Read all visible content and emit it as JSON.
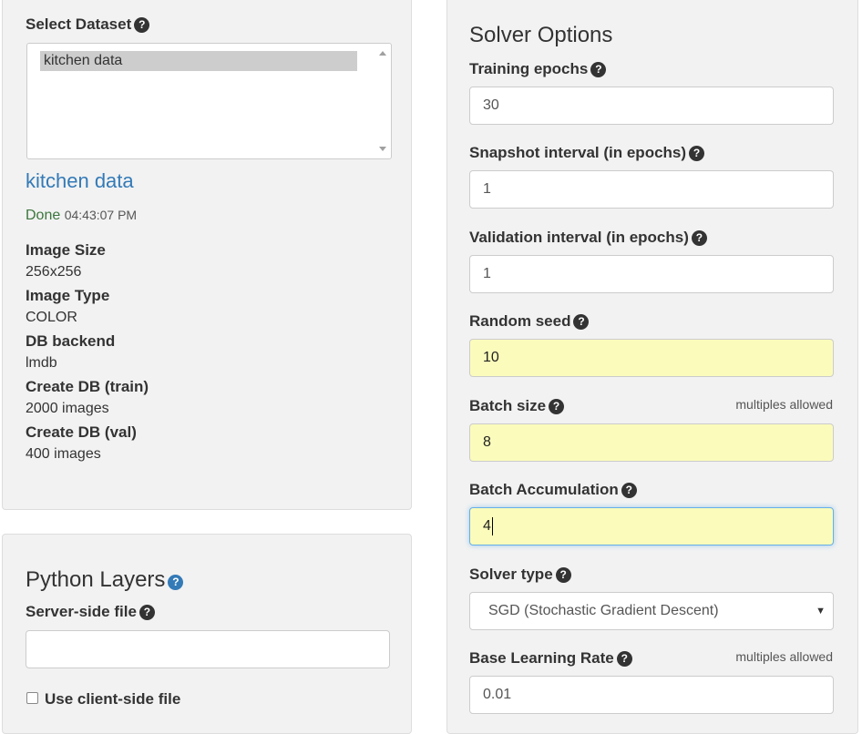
{
  "dataset": {
    "title": "Select Dataset",
    "options": [
      "kitchen data"
    ],
    "selected_name": "kitchen data",
    "status": "Done",
    "time": "04:43:07 PM",
    "info": [
      {
        "key": "Image Size",
        "value": "256x256"
      },
      {
        "key": "Image Type",
        "value": "COLOR"
      },
      {
        "key": "DB backend",
        "value": "lmdb"
      },
      {
        "key": "Create DB (train)",
        "value": "2000 images"
      },
      {
        "key": "Create DB (val)",
        "value": "400 images"
      }
    ]
  },
  "python_layers": {
    "title": "Python Layers",
    "server_file_label": "Server-side file",
    "server_file_value": "",
    "client_file_label": "Use client-side file"
  },
  "solver": {
    "title": "Solver Options",
    "training_epochs": {
      "label": "Training epochs",
      "value": "30"
    },
    "snapshot_interval": {
      "label": "Snapshot interval (in epochs)",
      "value": "1"
    },
    "validation_interval": {
      "label": "Validation interval (in epochs)",
      "value": "1"
    },
    "random_seed": {
      "label": "Random seed",
      "value": "10"
    },
    "batch_size": {
      "label": "Batch size",
      "value": "8",
      "hint": "multiples allowed"
    },
    "batch_accumulation": {
      "label": "Batch Accumulation",
      "value": "4"
    },
    "solver_type": {
      "label": "Solver type",
      "value": "SGD (Stochastic Gradient Descent)"
    },
    "base_lr": {
      "label": "Base Learning Rate",
      "value": "0.01",
      "hint": "multiples allowed"
    }
  },
  "icons": {
    "help": "question-circle-icon",
    "dropdown": "caret-down-icon"
  },
  "colors": {
    "link": "#337ab7",
    "done": "#3c763d",
    "highlight_input": "#fbfcbb",
    "focus_border": "#66afe9"
  }
}
